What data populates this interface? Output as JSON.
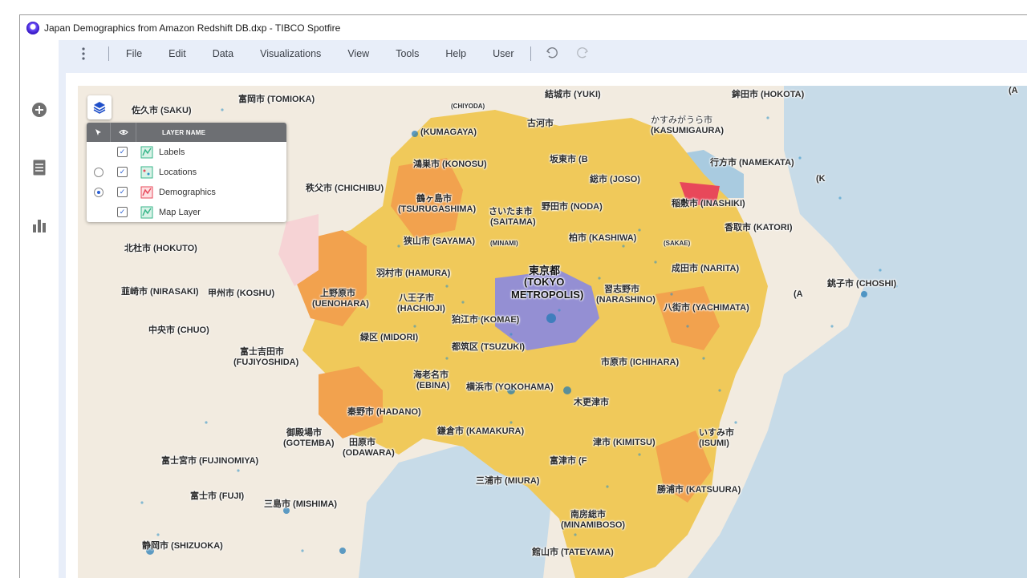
{
  "window": {
    "title": "Japan Demographics from Amazon Redshift DB.dxp - TIBCO Spotfire"
  },
  "sidebar": {
    "icons": [
      "add-icon",
      "data-table-icon",
      "bar-chart-icon"
    ]
  },
  "menu": {
    "items": [
      "File",
      "Edit",
      "Data",
      "Visualizations",
      "View",
      "Tools",
      "Help",
      "User"
    ]
  },
  "layers": {
    "header": "LAYER NAME",
    "rows": [
      {
        "name": "Labels",
        "visible": true,
        "selectable": false,
        "selected": false,
        "color": "#37b68a"
      },
      {
        "name": "Locations",
        "visible": true,
        "selectable": true,
        "selected": false,
        "color": "#37b68a"
      },
      {
        "name": "Demographics",
        "visible": true,
        "selectable": true,
        "selected": true,
        "color": "#e8485a"
      },
      {
        "name": "Map Layer",
        "visible": true,
        "selectable": false,
        "selected": false,
        "color": "#37b68a"
      }
    ]
  },
  "map": {
    "labels": [
      "佐久市 (SAKU)",
      "富岡市 (TOMIOKA)",
      "(CHIYODA)",
      "結城市 (YUKI)",
      "鉾田市 (HOKOTA)",
      "(KUMAGAYA)",
      "古河市",
      "かすみがうら市",
      "(KASUMIGAURA)",
      "鴻巣市 (KONOSU)",
      "坂東市 (B",
      "総市 (JOSO)",
      "行方市 (NAMEKATA)",
      "秩父市 (CHICHIBU)",
      "鶴ヶ島市",
      "(TSURUGASHIMA)",
      "さいたま市",
      "(SAITAMA)",
      "野田市 (NODA)",
      "稲敷市 (INASHIKI)",
      "香取市 (KATORI)",
      "狭山市 (SAYAMA)",
      "柏市 (KASHIWA)",
      "北杜市 (HOKUTO)",
      "(MINAMI)",
      "(SAKAE)",
      "羽村市 (HAMURA)",
      "成田市 (NARITA)",
      "東京都",
      "(TOKYO",
      "METROPOLIS)",
      "上野原市",
      "(UENOHARA)",
      "韮崎市 (NIRASAKI)",
      "甲州市 (KOSHU)",
      "八王子市",
      "(HACHIOJI)",
      "習志野市",
      "(NARASHINO)",
      "八街市 (YACHIMATA)",
      "銚子市 (CHOSHI)",
      "狛江市 (KOMAE)",
      "中央市 (CHUO)",
      "緑区 (MIDORI)",
      "都筑区 (TSUZUKI)",
      "富士吉田市",
      "(FUJIYOSHIDA)",
      "市原市 (ICHIHARA)",
      "海老名市",
      "(EBINA)",
      "横浜市 (YOKOHAMA)",
      "木更津市",
      "秦野市 (HADANO)",
      "御殿場市",
      "(GOTEMBA)",
      "鎌倉市 (KAMAKURA)",
      "津市 (KIMITSU)",
      "いすみ市",
      "(ISUMI)",
      "田原市",
      "(ODAWARA)",
      "富士宮市 (FUJINOMIYA)",
      "富津市 (F",
      "三浦市 (MIURA)",
      "勝浦市 (KATSUURA)",
      "富士市 (FUJI)",
      "三島市 (MISHIMA)",
      "南房総市",
      "(MINAMIBOSO)",
      "静岡市 (SHIZUOKA)",
      "館山市 (TATEYAMA)",
      "(A",
      "(A",
      "(K"
    ]
  }
}
